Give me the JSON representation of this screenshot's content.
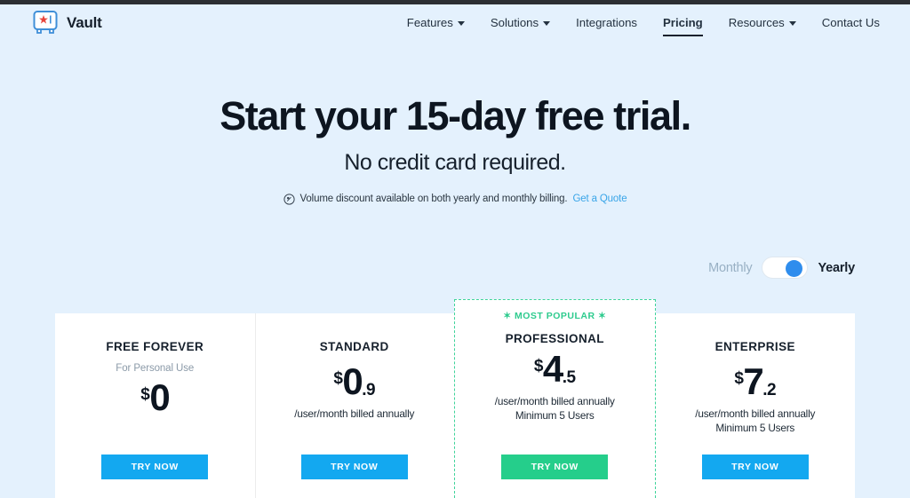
{
  "header": {
    "brand_name": "Vault",
    "brand_icon": "vault-star-icon",
    "nav": [
      {
        "label": "Features",
        "has_caret": true,
        "active": false
      },
      {
        "label": "Solutions",
        "has_caret": true,
        "active": false
      },
      {
        "label": "Integrations",
        "has_caret": false,
        "active": false
      },
      {
        "label": "Pricing",
        "has_caret": false,
        "active": true
      },
      {
        "label": "Resources",
        "has_caret": true,
        "active": false
      },
      {
        "label": "Contact Us",
        "has_caret": false,
        "active": false
      }
    ]
  },
  "hero": {
    "title": "Start your 15-day free trial.",
    "subtitle": "No credit card required.",
    "note_icon": "discount-tag-icon",
    "note_text": "Volume discount available on both yearly and monthly billing.",
    "note_link": "Get a Quote"
  },
  "billing": {
    "monthly_label": "Monthly",
    "yearly_label": "Yearly",
    "selected": "Yearly"
  },
  "colors": {
    "page_background": "#e4f1fd",
    "accent_blue": "#13a8f0",
    "accent_green": "#25ce8b",
    "link_blue": "#39a5e8",
    "toggle_knob": "#2f8ded",
    "muted_text": "#8b9aa8"
  },
  "plans": [
    {
      "name": "FREE FOREVER",
      "tagline": "For Personal Use",
      "currency": "$",
      "price_whole": "0",
      "price_frac": "",
      "meta_line1": "",
      "meta_line2": "",
      "cta_label": "TRY NOW",
      "cta_color": "#13a8f0",
      "featured": false,
      "badge": ""
    },
    {
      "name": "STANDARD",
      "tagline": "",
      "currency": "$",
      "price_whole": "0",
      "price_frac": ".9",
      "meta_line1": "/user/month billed annually",
      "meta_line2": "",
      "cta_label": "TRY NOW",
      "cta_color": "#13a8f0",
      "featured": false,
      "badge": ""
    },
    {
      "name": "PROFESSIONAL",
      "tagline": "",
      "currency": "$",
      "price_whole": "4",
      "price_frac": ".5",
      "meta_line1": "/user/month billed annually",
      "meta_line2": "Minimum 5 Users",
      "cta_label": "TRY NOW",
      "cta_color": "#25ce8b",
      "featured": true,
      "badge": "✶ MOST POPULAR ✶"
    },
    {
      "name": "ENTERPRISE",
      "tagline": "",
      "currency": "$",
      "price_whole": "7",
      "price_frac": ".2",
      "meta_line1": "/user/month billed annually",
      "meta_line2": "Minimum 5 Users",
      "cta_label": "TRY NOW",
      "cta_color": "#13a8f0",
      "featured": false,
      "badge": ""
    }
  ]
}
